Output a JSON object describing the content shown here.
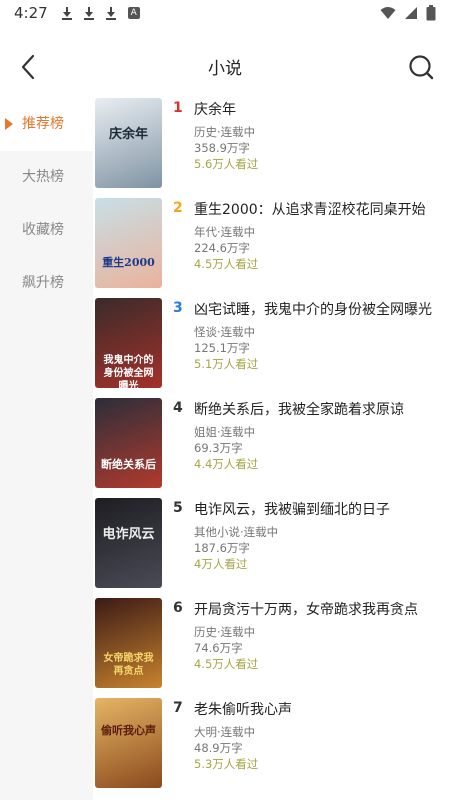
{
  "status_bar": {
    "time": "4:27",
    "a_icon_label": "A"
  },
  "header": {
    "title": "小说"
  },
  "sidebar": {
    "items": [
      {
        "label": "推荐榜",
        "active": true
      },
      {
        "label": "大热榜",
        "active": false
      },
      {
        "label": "收藏榜",
        "active": false
      },
      {
        "label": "飙升榜",
        "active": false
      }
    ]
  },
  "colors": {
    "accent": "#e8762b",
    "rank_1": "#e02f2f",
    "rank_2": "#f0a81c",
    "rank_3": "#2d7ad6",
    "rank_other": "#333333",
    "views": "#a7a544"
  },
  "books": [
    {
      "rank": "1",
      "title": "庆余年",
      "category": "历史·连载中",
      "words": "358.9万字",
      "views": "5.6万人看过",
      "cover_text": "庆余年",
      "cover_colors": [
        "#e9eef2",
        "#7f93a3"
      ]
    },
    {
      "rank": "2",
      "title": "重生2000：从追求青涩校花同桌开始",
      "category": "年代·连载中",
      "words": "224.6万字",
      "views": "4.5万人看过",
      "cover_text": "重生2000",
      "cover_colors": [
        "#c7dfe6",
        "#eab29c"
      ]
    },
    {
      "rank": "3",
      "title": "凶宅试睡，我鬼中介的身份被全网曝光",
      "category": "怪谈·连载中",
      "words": "125.1万字",
      "views": "5.1万人看过",
      "cover_text": "我鬼中介的身份被全网曝光",
      "cover_colors": [
        "#3a2b2a",
        "#a4312b"
      ]
    },
    {
      "rank": "4",
      "title": "断绝关系后，我被全家跪着求原谅",
      "category": "姐姐·连载中",
      "words": "69.3万字",
      "views": "4.4万人看过",
      "cover_text": "断绝关系后",
      "cover_colors": [
        "#2b2e3a",
        "#b23a2d"
      ]
    },
    {
      "rank": "5",
      "title": "电诈风云，我被骗到缅北的日子",
      "category": "其他小说·连载中",
      "words": "187.6万字",
      "views": "4万人看过",
      "cover_text": "电诈风云",
      "cover_colors": [
        "#1d1d22",
        "#4a4b55"
      ]
    },
    {
      "rank": "6",
      "title": "开局贪污十万两，女帝跪求我再贪点",
      "category": "历史·连载中",
      "words": "74.6万字",
      "views": "4.5万人看过",
      "cover_text": "女帝跪求我再贪点",
      "cover_colors": [
        "#3b1a16",
        "#c8832f"
      ]
    },
    {
      "rank": "7",
      "title": "老朱偷听我心声",
      "category": "大明·连载中",
      "words": "48.9万字",
      "views": "5.3万人看过",
      "cover_text": "偷听我心声",
      "cover_colors": [
        "#e6b565",
        "#8a4a1d"
      ]
    }
  ]
}
